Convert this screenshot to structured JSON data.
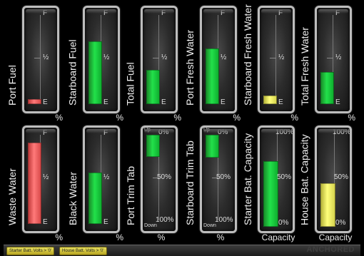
{
  "tanks_row1": [
    {
      "label": "Port Fuel",
      "top": "F",
      "mid": "½",
      "bottom": "E",
      "unit": "%",
      "color": "red",
      "level": 0.04
    },
    {
      "label": "Starboard Fuel",
      "top": "F",
      "mid": "½",
      "bottom": "E",
      "unit": "%",
      "color": "green",
      "level": 0.72
    },
    {
      "label": "Total Fuel",
      "top": "F",
      "mid": "½",
      "bottom": "E",
      "unit": "%",
      "color": "green",
      "level": 0.38
    },
    {
      "label": "Port Fresh Water",
      "top": "F",
      "mid": "½",
      "bottom": "E",
      "unit": "%",
      "color": "green",
      "level": 0.63
    },
    {
      "label": "Starboard Fresh Water",
      "top": "F",
      "mid": "½",
      "bottom": "E",
      "unit": "%",
      "color": "yellow",
      "level": 0.08
    },
    {
      "label": "Total Fresh Water",
      "top": "F",
      "mid": "½",
      "bottom": "E",
      "unit": "%",
      "color": "green",
      "level": 0.36
    }
  ],
  "tanks_row2": [
    {
      "label": "Waste Water",
      "top": "F",
      "mid": "½",
      "bottom": "E",
      "unit": "%",
      "color": "red",
      "level": 0.93
    },
    {
      "label": "Black Water",
      "top": "F",
      "mid": "½",
      "bottom": "E",
      "unit": "%",
      "color": "green",
      "level": 0.58
    }
  ],
  "trim_tabs": [
    {
      "label": "Port Trim Tab",
      "up": "Up",
      "down": "Down",
      "t0": "0%",
      "t50": "50%",
      "t100": "100%",
      "unit": "%",
      "color": "green",
      "level": 0.24
    },
    {
      "label": "Starboard Trim Tab",
      "up": "Up",
      "down": "Down",
      "t0": "0%",
      "t50": "50%",
      "t100": "100%",
      "unit": "%",
      "color": "green",
      "level": 0.25
    }
  ],
  "batteries": [
    {
      "label": "Starter Bat. Capacity",
      "t100": "100%",
      "t50": "50%",
      "t0": "0%",
      "unit": "Capacity",
      "color": "green",
      "level": 0.69
    },
    {
      "label": "House Bat. Capacity",
      "t100": "100%",
      "t50": "50%",
      "t0": "0%",
      "unit": "Capacity",
      "color": "yellow",
      "level": 0.45
    }
  ],
  "status": {
    "alarm1": "Starter Batt. Volts > '0'",
    "alarm2": "House Batt. Volts > '0'",
    "mode": "ANCHORED"
  },
  "colors": {
    "green": "#22e14a",
    "red": "#ff7a7a",
    "yellow": "#ffff7a",
    "frame": "#bdbdbd"
  }
}
